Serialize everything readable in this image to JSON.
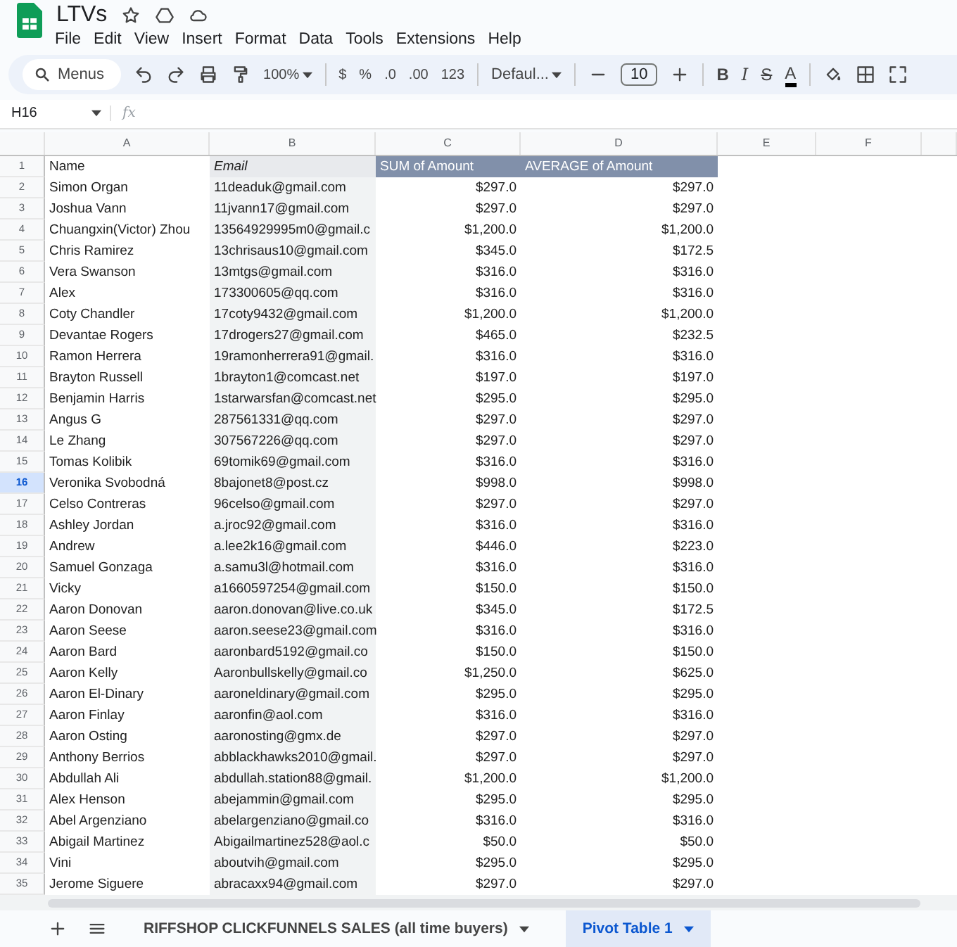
{
  "document": {
    "title": "LTVs"
  },
  "menu": [
    "File",
    "Edit",
    "View",
    "Insert",
    "Format",
    "Data",
    "Tools",
    "Extensions",
    "Help"
  ],
  "toolbar": {
    "search_placeholder": "Menus",
    "zoom": "100%",
    "currency": "$",
    "percent": "%",
    "decrease_decimals": ".0",
    "increase_decimals": ".00",
    "number_format": "123",
    "font": "Defaul...",
    "font_size": "10",
    "bold": "B",
    "italic": "I",
    "strikethrough": "S",
    "text_color": "A"
  },
  "formula_bar": {
    "cell_ref": "H16",
    "fx": "fx"
  },
  "columns": [
    "A",
    "B",
    "C",
    "D",
    "E",
    "F"
  ],
  "header_row": {
    "num": "1",
    "cells": [
      "Name",
      "Email",
      "SUM of Amount",
      "AVERAGE of Amount"
    ]
  },
  "rows": [
    {
      "num": "2",
      "name": "Simon Organ",
      "email": "11deaduk@gmail.com",
      "sum": "$297.0",
      "avg": "$297.0",
      "selected": false
    },
    {
      "num": "3",
      "name": "Joshua Vann",
      "email": "11jvann17@gmail.com",
      "sum": "$297.0",
      "avg": "$297.0",
      "selected": false
    },
    {
      "num": "4",
      "name": "Chuangxin(Victor) Zhou",
      "email": "13564929995m0@gmail.c",
      "sum": "$1,200.0",
      "avg": "$1,200.0",
      "selected": false
    },
    {
      "num": "5",
      "name": "Chris Ramirez",
      "email": "13chrisaus10@gmail.com",
      "sum": "$345.0",
      "avg": "$172.5",
      "selected": false
    },
    {
      "num": "6",
      "name": "Vera Swanson",
      "email": "13mtgs@gmail.com",
      "sum": "$316.0",
      "avg": "$316.0",
      "selected": false
    },
    {
      "num": "7",
      "name": "Alex",
      "email": "173300605@qq.com",
      "sum": "$316.0",
      "avg": "$316.0",
      "selected": false
    },
    {
      "num": "8",
      "name": "Coty Chandler",
      "email": "17coty9432@gmail.com",
      "sum": "$1,200.0",
      "avg": "$1,200.0",
      "selected": false
    },
    {
      "num": "9",
      "name": "Devantae Rogers",
      "email": "17drogers27@gmail.com",
      "sum": "$465.0",
      "avg": "$232.5",
      "selected": false
    },
    {
      "num": "10",
      "name": "Ramon Herrera",
      "email": "19ramonherrera91@gmail.",
      "sum": "$316.0",
      "avg": "$316.0",
      "selected": false
    },
    {
      "num": "11",
      "name": "Brayton Russell",
      "email": "1brayton1@comcast.net",
      "sum": "$197.0",
      "avg": "$197.0",
      "selected": false
    },
    {
      "num": "12",
      "name": "Benjamin Harris",
      "email": "1starwarsfan@comcast.net",
      "sum": "$295.0",
      "avg": "$295.0",
      "selected": false
    },
    {
      "num": "13",
      "name": "Angus G",
      "email": "287561331@qq.com",
      "sum": "$297.0",
      "avg": "$297.0",
      "selected": false
    },
    {
      "num": "14",
      "name": "Le Zhang",
      "email": "307567226@qq.com",
      "sum": "$297.0",
      "avg": "$297.0",
      "selected": false
    },
    {
      "num": "15",
      "name": "Tomas Kolibik",
      "email": "69tomik69@gmail.com",
      "sum": "$316.0",
      "avg": "$316.0",
      "selected": false
    },
    {
      "num": "16",
      "name": "Veronika Svobodná",
      "email": "8bajonet8@post.cz",
      "sum": "$998.0",
      "avg": "$998.0",
      "selected": true
    },
    {
      "num": "17",
      "name": "Celso Contreras",
      "email": "96celso@gmail.com",
      "sum": "$297.0",
      "avg": "$297.0",
      "selected": false
    },
    {
      "num": "18",
      "name": "Ashley Jordan",
      "email": "a.jroc92@gmail.com",
      "sum": "$316.0",
      "avg": "$316.0",
      "selected": false
    },
    {
      "num": "19",
      "name": "Andrew",
      "email": "a.lee2k16@gmail.com",
      "sum": "$446.0",
      "avg": "$223.0",
      "selected": false
    },
    {
      "num": "20",
      "name": "Samuel Gonzaga",
      "email": "a.samu3l@hotmail.com",
      "sum": "$316.0",
      "avg": "$316.0",
      "selected": false
    },
    {
      "num": "21",
      "name": "Vicky",
      "email": "a1660597254@gmail.com",
      "sum": "$150.0",
      "avg": "$150.0",
      "selected": false
    },
    {
      "num": "22",
      "name": "Aaron Donovan",
      "email": "aaron.donovan@live.co.uk",
      "sum": "$345.0",
      "avg": "$172.5",
      "selected": false
    },
    {
      "num": "23",
      "name": "Aaron Seese",
      "email": "aaron.seese23@gmail.com",
      "sum": "$316.0",
      "avg": "$316.0",
      "selected": false
    },
    {
      "num": "24",
      "name": "Aaron Bard",
      "email": "aaronbard5192@gmail.co",
      "sum": "$150.0",
      "avg": "$150.0",
      "selected": false
    },
    {
      "num": "25",
      "name": "Aaron Kelly",
      "email": "Aaronbullskelly@gmail.co",
      "sum": "$1,250.0",
      "avg": "$625.0",
      "selected": false
    },
    {
      "num": "26",
      "name": "Aaron El-Dinary",
      "email": "aaroneldinary@gmail.com",
      "sum": "$295.0",
      "avg": "$295.0",
      "selected": false
    },
    {
      "num": "27",
      "name": "Aaron Finlay",
      "email": "aaronfin@aol.com",
      "sum": "$316.0",
      "avg": "$316.0",
      "selected": false
    },
    {
      "num": "28",
      "name": "Aaron Osting",
      "email": "aaronosting@gmx.de",
      "sum": "$297.0",
      "avg": "$297.0",
      "selected": false
    },
    {
      "num": "29",
      "name": "Anthony Berrios",
      "email": "abblackhawks2010@gmail.",
      "sum": "$297.0",
      "avg": "$297.0",
      "selected": false
    },
    {
      "num": "30",
      "name": "Abdullah Ali",
      "email": "abdullah.station88@gmail.",
      "sum": "$1,200.0",
      "avg": "$1,200.0",
      "selected": false
    },
    {
      "num": "31",
      "name": "Alex Henson",
      "email": "abejammin@gmail.com",
      "sum": "$295.0",
      "avg": "$295.0",
      "selected": false
    },
    {
      "num": "32",
      "name": "Abel Argenziano",
      "email": "abelargenziano@gmail.co",
      "sum": "$316.0",
      "avg": "$316.0",
      "selected": false
    },
    {
      "num": "33",
      "name": "Abigail Martinez",
      "email": "Abigailmartinez528@aol.c",
      "sum": "$50.0",
      "avg": "$50.0",
      "selected": false
    },
    {
      "num": "34",
      "name": "Vini",
      "email": "aboutvih@gmail.com",
      "sum": "$295.0",
      "avg": "$295.0",
      "selected": false
    },
    {
      "num": "35",
      "name": "Jerome Siguere",
      "email": "abracaxx94@gmail.com",
      "sum": "$297.0",
      "avg": "$297.0",
      "selected": false
    }
  ],
  "sheet_tabs": [
    {
      "label": "RIFFSHOP CLICKFUNNELS SALES (all time buyers)",
      "selected": false
    },
    {
      "label": "Pivot Table 1",
      "selected": true
    }
  ]
}
